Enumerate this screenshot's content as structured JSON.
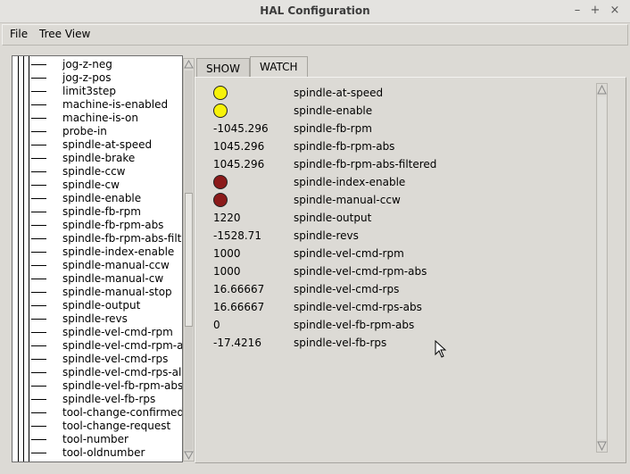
{
  "window": {
    "title": "HAL Configuration",
    "minimize_glyph": "–",
    "maximize_glyph": "+",
    "close_glyph": "×"
  },
  "menu": {
    "items": [
      {
        "label": "File"
      },
      {
        "label": "Tree View"
      }
    ]
  },
  "tree": {
    "items": [
      "jog-z-neg",
      "jog-z-pos",
      "limit3step",
      "machine-is-enabled",
      "machine-is-on",
      "probe-in",
      "spindle-at-speed",
      "spindle-brake",
      "spindle-ccw",
      "spindle-cw",
      "spindle-enable",
      "spindle-fb-rpm",
      "spindle-fb-rpm-abs",
      "spindle-fb-rpm-abs-filt",
      "spindle-index-enable",
      "spindle-manual-ccw",
      "spindle-manual-cw",
      "spindle-manual-stop",
      "spindle-output",
      "spindle-revs",
      "spindle-vel-cmd-rpm",
      "spindle-vel-cmd-rpm-a",
      "spindle-vel-cmd-rps",
      "spindle-vel-cmd-rps-al",
      "spindle-vel-fb-rpm-abs",
      "spindle-vel-fb-rps",
      "tool-change-confirmed",
      "tool-change-request",
      "tool-number",
      "tool-oldnumber"
    ]
  },
  "tabs": [
    {
      "label": "SHOW",
      "active": false
    },
    {
      "label": "WATCH",
      "active": true
    }
  ],
  "colors": {
    "led_on": "#f7f20a",
    "led_off": "#8b1a1a"
  },
  "watch": {
    "rows": [
      {
        "kind": "led",
        "state": "on",
        "value": "",
        "name": "spindle-at-speed"
      },
      {
        "kind": "led",
        "state": "on",
        "value": "",
        "name": "spindle-enable"
      },
      {
        "kind": "value",
        "state": "",
        "value": "-1045.296",
        "name": "spindle-fb-rpm"
      },
      {
        "kind": "value",
        "state": "",
        "value": "1045.296",
        "name": "spindle-fb-rpm-abs"
      },
      {
        "kind": "value",
        "state": "",
        "value": "1045.296",
        "name": "spindle-fb-rpm-abs-filtered"
      },
      {
        "kind": "led",
        "state": "off",
        "value": "",
        "name": "spindle-index-enable"
      },
      {
        "kind": "led",
        "state": "off",
        "value": "",
        "name": "spindle-manual-ccw"
      },
      {
        "kind": "value",
        "state": "",
        "value": "1220",
        "name": "spindle-output"
      },
      {
        "kind": "value",
        "state": "",
        "value": "-1528.71",
        "name": "spindle-revs"
      },
      {
        "kind": "value",
        "state": "",
        "value": "1000",
        "name": "spindle-vel-cmd-rpm"
      },
      {
        "kind": "value",
        "state": "",
        "value": "1000",
        "name": "spindle-vel-cmd-rpm-abs"
      },
      {
        "kind": "value",
        "state": "",
        "value": "16.66667",
        "name": "spindle-vel-cmd-rps"
      },
      {
        "kind": "value",
        "state": "",
        "value": "16.66667",
        "name": "spindle-vel-cmd-rps-abs"
      },
      {
        "kind": "value",
        "state": "",
        "value": "0",
        "name": "spindle-vel-fb-rpm-abs"
      },
      {
        "kind": "value",
        "state": "",
        "value": "-17.4216",
        "name": "spindle-vel-fb-rps"
      }
    ]
  }
}
